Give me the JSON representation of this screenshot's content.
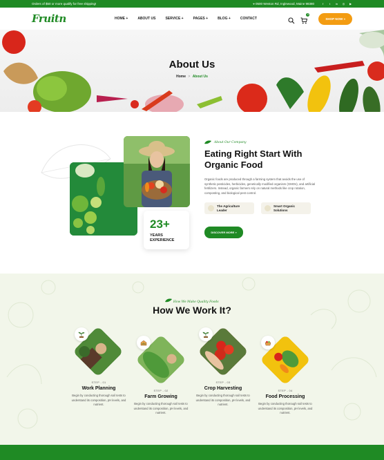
{
  "topbar": {
    "promo": "Orders of $50 or more qualify for free shipping!",
    "address": "0500 Weston Rd, Inglewood, Maine 98380",
    "social": [
      {
        "icon": "facebook-icon",
        "glyph": "f"
      },
      {
        "icon": "twitter-icon",
        "glyph": "t"
      },
      {
        "icon": "linkedin-icon",
        "glyph": "in"
      },
      {
        "icon": "instagram-icon",
        "glyph": "◎"
      },
      {
        "icon": "youtube-icon",
        "glyph": "▶"
      }
    ]
  },
  "header": {
    "logo": "Fruitn",
    "nav": [
      "HOME +",
      "ABOUT US",
      "SERVICE +",
      "PAGES +",
      "BLOG +",
      "CONTACT"
    ],
    "cart_count": "0",
    "shop_button": "SHOP NOW »"
  },
  "hero": {
    "title": "About Us",
    "breadcrumb_home": "Home",
    "breadcrumb_sep": ">",
    "breadcrumb_current": "About Us"
  },
  "about": {
    "experience_number": "23+",
    "experience_label": "YEARS EXPERIENCE",
    "tagline": "About Our Company",
    "title": "Eating Right Start With Organic Food",
    "description": "Organic foods are produced through a farming system that avoids the use of synthetic pesticides, herbicides, genetically modified organism (GMOs), and artificial fertilizers. Instead, organic farmers rely on natural methods like crop rotation, composting, and biological pest control.",
    "features": [
      "The Agriculture Leader",
      "Smart Organic Solutions"
    ],
    "discover_button": "DISCOVER MORE »"
  },
  "work": {
    "tagline": "How We Make Quality Foods",
    "title": "How We Work It?",
    "steps": [
      {
        "num": "STEP - 01",
        "title": "Work Planning",
        "desc": "Begin by conducting thorough soil tests to understand its composition, pH levels, and nutrient."
      },
      {
        "num": "STEP - 02",
        "title": "Farm Growing",
        "desc": "Begin by conducting thorough soil tests to understand its composition, pH levels, and nutrient."
      },
      {
        "num": "STEP - 03",
        "title": "Crop Harvesting",
        "desc": "Begin by conducting thorough soil tests to understand its composition, pH levels, and nutrient."
      },
      {
        "num": "STEP - 04",
        "title": "Food Processing",
        "desc": "Begin by conducting thorough soil tests to understand its composition, pH levels, and nutrient."
      }
    ]
  },
  "colors": {
    "brand_green": "#1f8a24",
    "accent_orange": "#f39c12",
    "section_bg": "#f2f6ea"
  }
}
